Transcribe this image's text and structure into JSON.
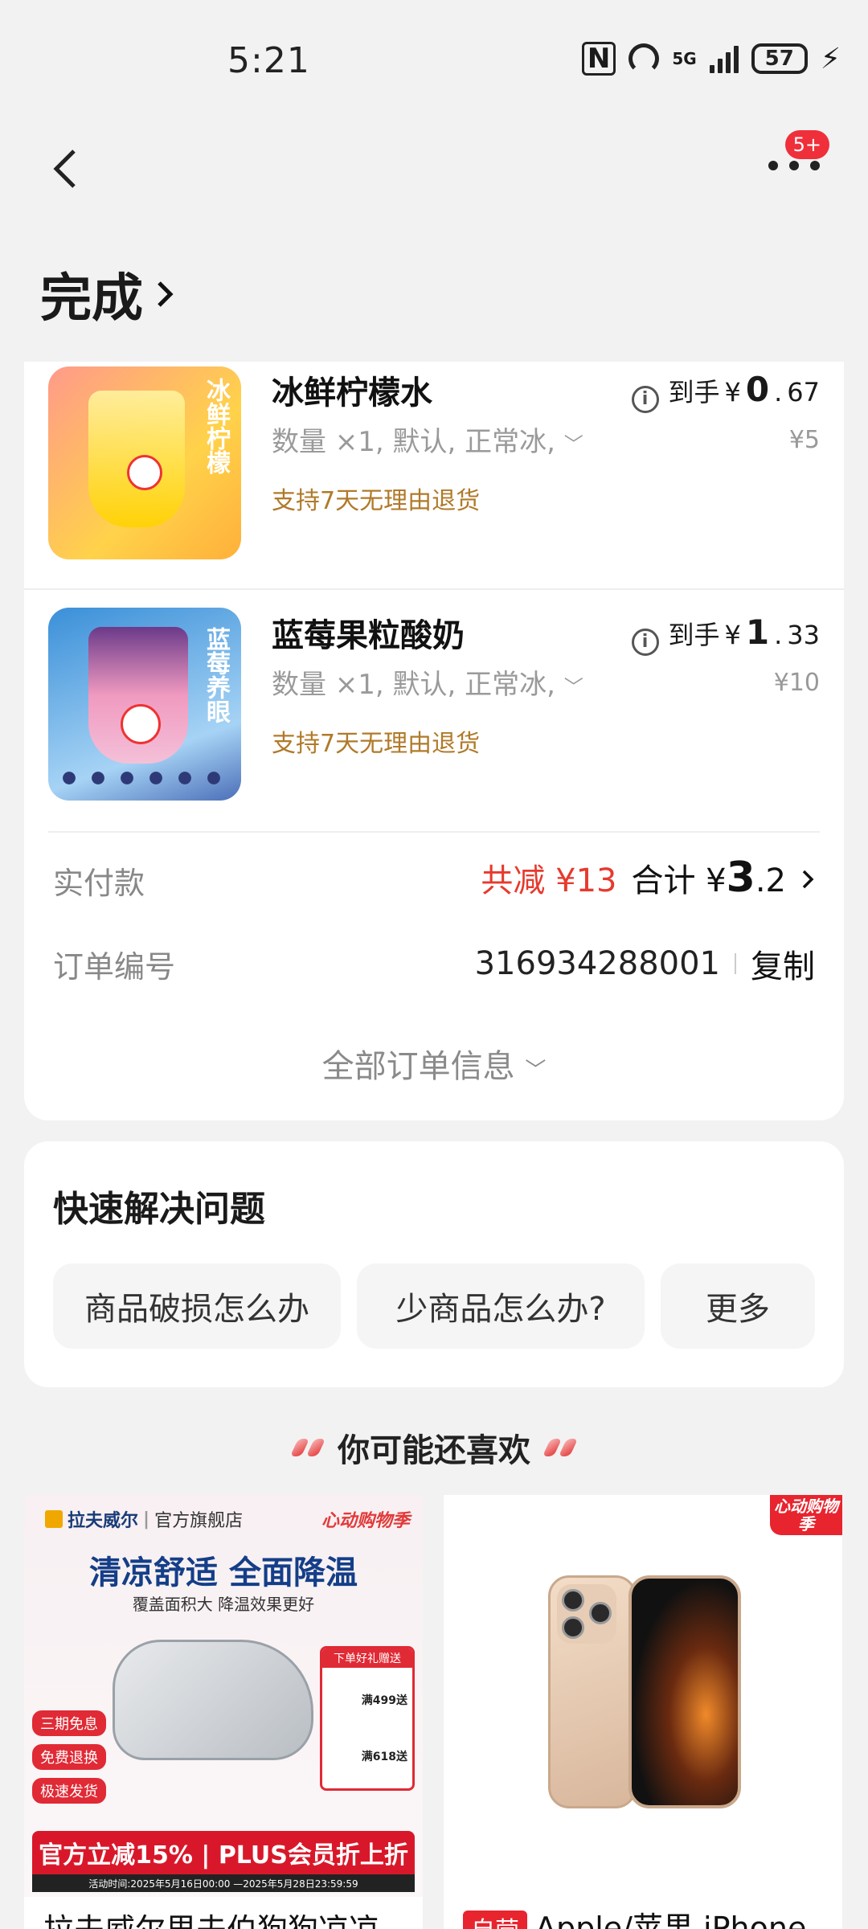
{
  "status_bar": {
    "time": "5:21",
    "battery": "57",
    "network": "5G"
  },
  "header": {
    "more_badge": "5+"
  },
  "page": {
    "title": "完成"
  },
  "items": [
    {
      "name": "冰鲜柠檬水",
      "spec": "数量 ×1, 默认, 正常冰,",
      "policy": "支持7天无理由退货",
      "price_label": "到手",
      "price_prefix": "¥0.",
      "price_main": "67",
      "price_int": "0",
      "orig": "¥5",
      "thumb_text": "冰鲜柠檬"
    },
    {
      "name": "蓝莓果粒酸奶",
      "spec": "数量 ×1, 默认, 正常冰,",
      "policy": "支持7天无理由退货",
      "price_label": "到手",
      "price_int": "1",
      "price_main": "33",
      "orig": "¥10",
      "thumb_text": "蓝莓养眼"
    }
  ],
  "payment": {
    "label": "实付款",
    "discount": "共减 ¥13",
    "total_label": "合计 ¥",
    "total_int": "3",
    "total_dec": ".2"
  },
  "order": {
    "label": "订单编号",
    "number": "316934288001",
    "copy": "复制"
  },
  "all_info": "全部订单信息",
  "quick": {
    "title": "快速解决问题",
    "buttons": [
      "商品破损怎么办",
      "少商品怎么办?",
      "更多"
    ]
  },
  "recommend": {
    "title": "你可能还喜欢",
    "left": {
      "brand": "拉夫威尔",
      "store": "官方旗舰店",
      "promo_tag": "心动购物季",
      "headline": "清凉舒适 全面降温",
      "sub": "覆盖面积大 降温效果更好",
      "side_tags": [
        "三期免息",
        "免费退换",
        "极速发货"
      ],
      "gift_title": "下单好礼赠送",
      "gift_1": "满499送",
      "gift_2": "满618送",
      "banner": "官方立减15% | PLUS会员折上折",
      "time": "活动时间:2025年5月16日00:00 —2025年5月28日23:59:59",
      "name": "拉夫威尔里夫伯狗狗凉凉"
    },
    "right": {
      "promo_tag": "心动购物季",
      "self_tag": "自营",
      "name": "Apple/苹果 iPhone"
    }
  }
}
